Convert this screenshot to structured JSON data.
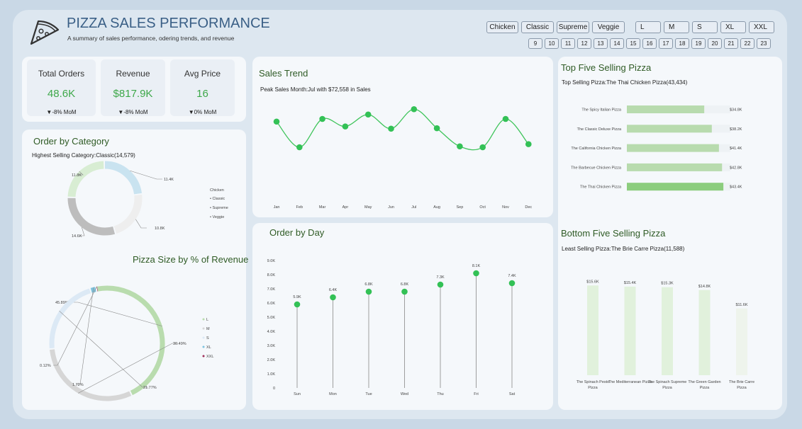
{
  "header": {
    "title": "PIZZA SALES PERFORMANCE",
    "subtitle": "A summary of sales performance, odering trends, and revenue",
    "icon": "pizza-slice-icon"
  },
  "slicers": {
    "categories": [
      "Chicken",
      "Classic",
      "Supreme",
      "Veggie"
    ],
    "sizes": [
      "L",
      "M",
      "S",
      "XL",
      "XXL"
    ],
    "days": [
      "9",
      "10",
      "11",
      "12",
      "13",
      "14",
      "15",
      "16",
      "17",
      "18",
      "19",
      "20",
      "21",
      "22",
      "23"
    ]
  },
  "kpis": [
    {
      "label": "Total Orders",
      "value": "48.6K",
      "mom": "▼-8% MoM"
    },
    {
      "label": "Revenue",
      "value": "$817.9K",
      "mom": "▼-8% MoM"
    },
    {
      "label": "Avg Price",
      "value": "16",
      "mom": "▼0% MoM"
    }
  ],
  "order_by_category": {
    "title": "Order by Category",
    "subtitle": "Highest Selling Category:Classic(14,579)",
    "legend": [
      "Chicken",
      "Classic",
      "Supreme",
      "Veggie"
    ],
    "slice_labels": [
      "11.4K",
      "10.8K",
      "14.6K",
      "11.8K"
    ]
  },
  "pizza_size": {
    "title": "Pizza Size by % of Revenue",
    "legend": [
      "L",
      "M",
      "S",
      "XL",
      "XXL"
    ],
    "slice_labels": [
      "45.89%",
      "30.49%",
      "21.77%",
      "1.72%",
      "0.12%"
    ]
  },
  "sales_trend": {
    "title": "Sales Trend",
    "subtitle": "Peak Sales Month:Jul with $72,558 in Sales"
  },
  "order_by_day": {
    "title": "Order by Day"
  },
  "top_five": {
    "title": "Top Five Selling Pizza",
    "subtitle": "Top Selling Pizza:The Thai Chicken Pizza(43,434)"
  },
  "bottom_five": {
    "title": "Bottom Five Selling Pizza",
    "subtitle": "Least Selling Pizza:The Brie Carre Pizza(11,588)"
  },
  "colors": {
    "accent_green": "#3ea84a",
    "title_green": "#2f5b25",
    "title_blue": "#3a5f86"
  },
  "chart_data": [
    {
      "id": "category",
      "type": "pie",
      "categories": [
        "Chicken",
        "Classic",
        "Supreme",
        "Veggie"
      ],
      "values": [
        11.4,
        10.8,
        14.6,
        11.8
      ],
      "value_labels": [
        "11.4K",
        "10.8K",
        "14.6K",
        "11.8K"
      ],
      "colors": [
        "#c9e3f0",
        "#eeeeee",
        "#bdbdbd",
        "#d8edd3"
      ],
      "legend": "right"
    },
    {
      "id": "size",
      "type": "pie",
      "categories": [
        "L",
        "M",
        "S",
        "XL",
        "XXL"
      ],
      "values": [
        45.89,
        30.49,
        21.77,
        1.72,
        0.12
      ],
      "value_labels": [
        "45.89%",
        "30.49%",
        "21.77%",
        "1.72%",
        "0.12%"
      ],
      "colors": [
        "#b9dcae",
        "#d6d6d6",
        "#dce9f5",
        "#7fc4df",
        "#a0305a"
      ],
      "legend": "right"
    },
    {
      "id": "trend",
      "type": "line",
      "categories": [
        "Jan",
        "Feb",
        "Mar",
        "Apr",
        "May",
        "Jun",
        "Jul",
        "Aug",
        "Sep",
        "Oct",
        "Nov",
        "Dec"
      ],
      "values": [
        69.8,
        64.0,
        70.4,
        68.7,
        71.4,
        68.2,
        72.6,
        68.3,
        64.2,
        64.0,
        70.4,
        64.7
      ],
      "ylim": [
        60,
        76
      ],
      "grid": false
    },
    {
      "id": "day",
      "type": "scatter",
      "categories": [
        "Sun",
        "Mon",
        "Tue",
        "Wed",
        "Thu",
        "Fri",
        "Sat"
      ],
      "values": [
        5.9,
        6.4,
        6.8,
        6.8,
        7.3,
        8.1,
        7.4
      ],
      "value_labels": [
        "5.9K",
        "6.4K",
        "6.8K",
        "6.8K",
        "7.3K",
        "8.1K",
        "7.4K"
      ],
      "yticks": [
        "0",
        "1.0K",
        "2.0K",
        "3.0K",
        "4.0K",
        "5.0K",
        "6.0K",
        "7.0K",
        "8.0K",
        "9.0K"
      ],
      "ylim": [
        0,
        9
      ]
    },
    {
      "id": "top",
      "type": "bar",
      "orientation": "horizontal",
      "categories": [
        "The Spicy Italian Pizza",
        "The Classic Deluxe Pizza",
        "The California Chicken Pizza",
        "The Barbecue Chicken Pizza",
        "The Thai Chicken Pizza"
      ],
      "values": [
        34.8,
        38.2,
        41.4,
        42.8,
        43.4
      ],
      "value_labels": [
        "$34.8K",
        "$38.2K",
        "$41.4K",
        "$42.8K",
        "$43.4K"
      ],
      "xlim": [
        0,
        44
      ]
    },
    {
      "id": "bottom",
      "type": "bar",
      "categories": [
        "The Spinach Pesto Pizza",
        "The Mediterranean Pizza",
        "The Spinach Supreme Pizza",
        "The Green Garden Pizza",
        "The Brie Carre Pizza"
      ],
      "values": [
        15.6,
        15.4,
        15.3,
        14.8,
        11.6
      ],
      "value_labels": [
        "$15.6K",
        "$15.4K",
        "$15.3K",
        "$14.8K",
        "$11.6K"
      ],
      "ylim": [
        0,
        16
      ]
    }
  ]
}
